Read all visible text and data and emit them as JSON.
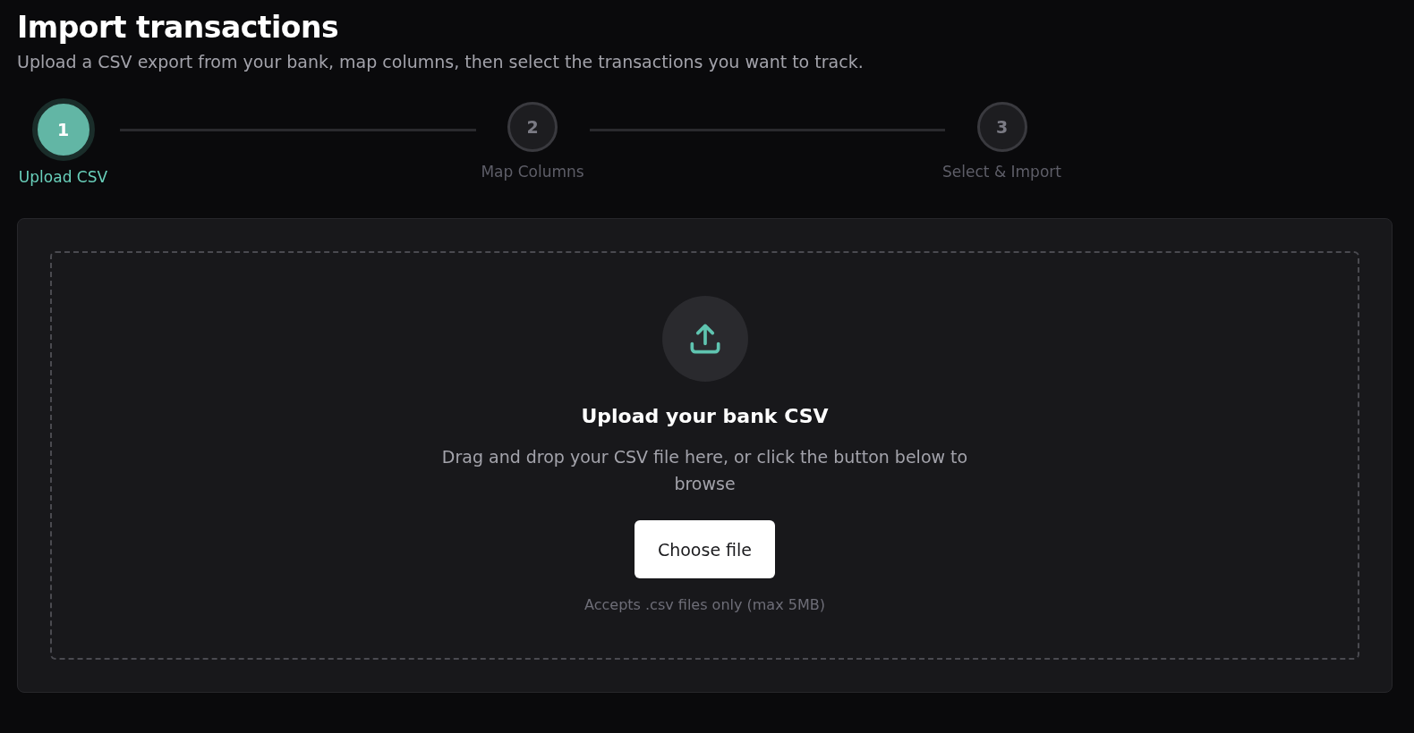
{
  "header": {
    "title": "Import transactions",
    "subtitle": "Upload a CSV export from your bank, map columns, then select the transactions you want to track."
  },
  "steps": [
    {
      "number": "1",
      "label": "Upload CSV",
      "selected": true
    },
    {
      "number": "2",
      "label": "Map Columns",
      "selected": false
    },
    {
      "number": "3",
      "label": "Select & Import",
      "selected": false
    }
  ],
  "dropzone": {
    "title": "Upload your bank CSV",
    "description": "Drag and drop your CSV file here, or click the button below to browse",
    "button": "Choose file",
    "hint": "Accepts .csv files only (max 5MB)"
  }
}
